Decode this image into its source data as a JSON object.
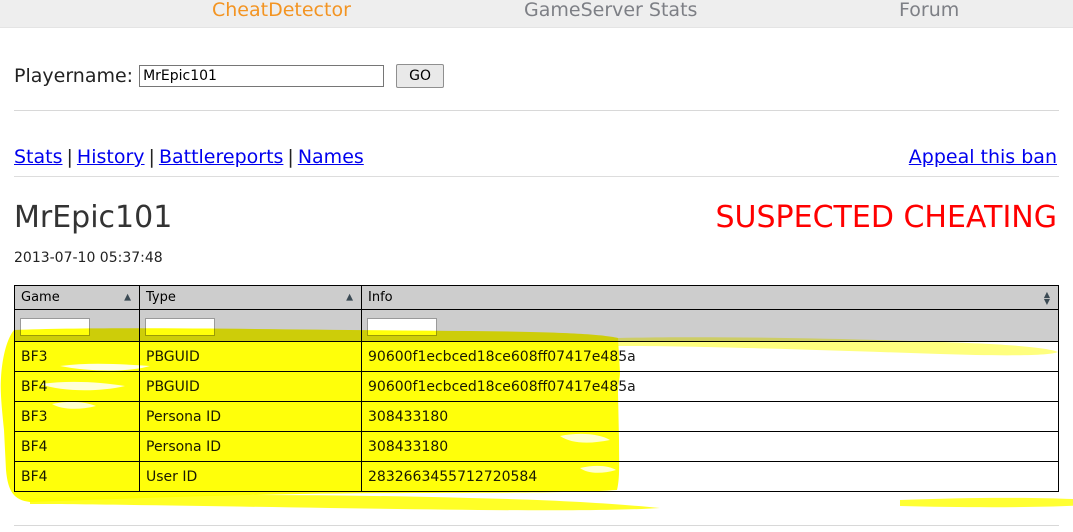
{
  "topnav": {
    "items": [
      {
        "label": "CheatDetector",
        "brand": true
      },
      {
        "label": "GameServer Stats",
        "brand": false
      },
      {
        "label": "Forum",
        "brand": false
      }
    ]
  },
  "search": {
    "label": "Playername:",
    "value": "MrEpic101",
    "placeholder": "",
    "button_label": "GO"
  },
  "subnav": {
    "items": [
      {
        "label": "Stats"
      },
      {
        "label": "History"
      },
      {
        "label": "Battlereports"
      },
      {
        "label": "Names"
      }
    ],
    "separator": "|",
    "appeal_label": "Appeal this ban"
  },
  "player": {
    "name": "MrEpic101",
    "date": "2013-07-10 05:37:48",
    "ban_status": "SUSPECTED CHEATING",
    "ban_status_color": "#ff0000"
  },
  "table": {
    "columns": [
      {
        "label": "Game",
        "sort": "asc",
        "filter_value": "",
        "filter_placeholder": ""
      },
      {
        "label": "Type",
        "sort": "asc",
        "filter_value": "",
        "filter_placeholder": ""
      },
      {
        "label": "Info",
        "sort": "both",
        "filter_value": "",
        "filter_placeholder": ""
      }
    ],
    "rows": [
      {
        "game": "BF3",
        "type": "PBGUID",
        "info": "90600f1ecbced18ce608ff07417e485a"
      },
      {
        "game": "BF4",
        "type": "PBGUID",
        "info": "90600f1ecbced18ce608ff07417e485a"
      },
      {
        "game": "BF3",
        "type": "Persona ID",
        "info": "308433180"
      },
      {
        "game": "BF4",
        "type": "Persona ID",
        "info": "308433180"
      },
      {
        "game": "BF4",
        "type": "User ID",
        "info": "2832663455712720584"
      }
    ]
  },
  "annotation": {
    "highlight_color": "#ffff00",
    "description": "yellow-highlighter-marking"
  },
  "theme": {
    "brand_color": "#f39422",
    "link_color": "#0000ee",
    "nav_text_color": "#7d7f85",
    "header_bg": "#cdcdcd"
  }
}
